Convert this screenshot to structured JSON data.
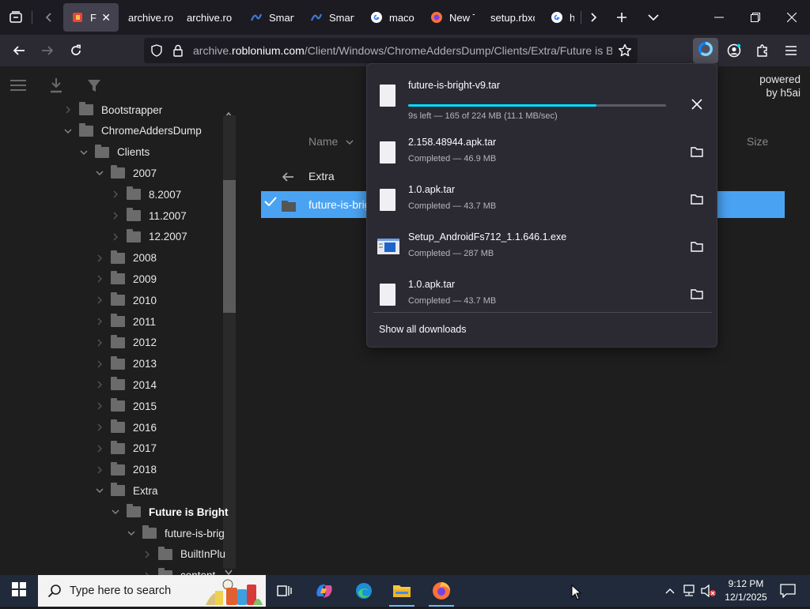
{
  "tabs": [
    {
      "label": "Futi",
      "active": true,
      "icon": "roblox-tab-icon"
    },
    {
      "label": "archive.ro",
      "active": false,
      "icon": ""
    },
    {
      "label": "archive.ro",
      "active": false,
      "icon": ""
    },
    {
      "label": "Smart",
      "active": false,
      "icon": "smart-tab-icon"
    },
    {
      "label": "Smart",
      "active": false,
      "icon": "smart-tab-icon"
    },
    {
      "label": "macos",
      "active": false,
      "icon": "google-icon"
    },
    {
      "label": "New T",
      "active": false,
      "icon": "firefox-icon"
    },
    {
      "label": "setup.rbxc",
      "active": false,
      "icon": ""
    },
    {
      "label": "how",
      "active": false,
      "icon": "google-icon"
    }
  ],
  "url": {
    "prefix": "archive.",
    "domain": "roblonium.com",
    "path": "/Client/Windows/ChromeAddersDump/Clients/Extra/Future is Bri"
  },
  "h5ai": {
    "powered_line1": "powered",
    "powered_line2": "by h5ai"
  },
  "tree": [
    {
      "label": "Bootstrapper",
      "depth": 0,
      "chev": "right",
      "bold": false
    },
    {
      "label": "ChromeAddersDump",
      "depth": 0,
      "chev": "down",
      "bold": false
    },
    {
      "label": "Clients",
      "depth": 1,
      "chev": "down",
      "bold": false
    },
    {
      "label": "2007",
      "depth": 2,
      "chev": "down",
      "bold": false
    },
    {
      "label": "8.2007",
      "depth": 3,
      "chev": "right",
      "bold": false
    },
    {
      "label": "11.2007",
      "depth": 3,
      "chev": "right",
      "bold": false
    },
    {
      "label": "12.2007",
      "depth": 3,
      "chev": "right",
      "bold": false
    },
    {
      "label": "2008",
      "depth": 2,
      "chev": "right",
      "bold": false
    },
    {
      "label": "2009",
      "depth": 2,
      "chev": "right",
      "bold": false
    },
    {
      "label": "2010",
      "depth": 2,
      "chev": "right",
      "bold": false
    },
    {
      "label": "2011",
      "depth": 2,
      "chev": "right",
      "bold": false
    },
    {
      "label": "2012",
      "depth": 2,
      "chev": "right",
      "bold": false
    },
    {
      "label": "2013",
      "depth": 2,
      "chev": "right",
      "bold": false
    },
    {
      "label": "2014",
      "depth": 2,
      "chev": "right",
      "bold": false
    },
    {
      "label": "2015",
      "depth": 2,
      "chev": "right",
      "bold": false
    },
    {
      "label": "2016",
      "depth": 2,
      "chev": "right",
      "bold": false
    },
    {
      "label": "2017",
      "depth": 2,
      "chev": "right",
      "bold": false
    },
    {
      "label": "2018",
      "depth": 2,
      "chev": "right",
      "bold": false
    },
    {
      "label": "Extra",
      "depth": 2,
      "chev": "down",
      "bold": false
    },
    {
      "label": "Future is Bright",
      "depth": 3,
      "chev": "down",
      "bold": true
    },
    {
      "label": "future-is-brig",
      "depth": 4,
      "chev": "down",
      "bold": false
    },
    {
      "label": "BuiltInPlu",
      "depth": 5,
      "chev": "right",
      "bold": false
    },
    {
      "label": "content",
      "depth": 5,
      "chev": "right",
      "bold": false
    }
  ],
  "main": {
    "col_name": "Name",
    "col_size": "Size",
    "parent_label": "Extra",
    "selected_label": "future-is-brig"
  },
  "downloads": {
    "items": [
      {
        "name": "future-is-bright-v9.tar",
        "status": "9s left — 165 of 224 MB (11.1 MB/sec)",
        "in_progress": true,
        "progress": 0.73,
        "icon": "file-icon"
      },
      {
        "name": "2.158.48944.apk.tar",
        "status": "Completed — 46.9 MB",
        "in_progress": false,
        "icon": "file-icon"
      },
      {
        "name": "1.0.apk.tar",
        "status": "Completed — 43.7 MB",
        "in_progress": false,
        "icon": "file-icon"
      },
      {
        "name": "Setup_AndroidFs712_1.1.646.1.exe",
        "status": "Completed — 287 MB",
        "in_progress": false,
        "icon": "installer-icon"
      },
      {
        "name": "1.0.apk.tar",
        "status": "Completed — 43.7 MB",
        "in_progress": false,
        "icon": "file-icon"
      }
    ],
    "show_all": "Show all downloads"
  },
  "taskbar": {
    "search_placeholder": "Type here to search",
    "time": "9:12 PM",
    "date": "12/1/2025"
  },
  "colors": {
    "accent": "#00ddff",
    "selection": "#4aa3f2",
    "page_bg": "#1e1e1e",
    "panel_bg": "#2b2a33"
  }
}
